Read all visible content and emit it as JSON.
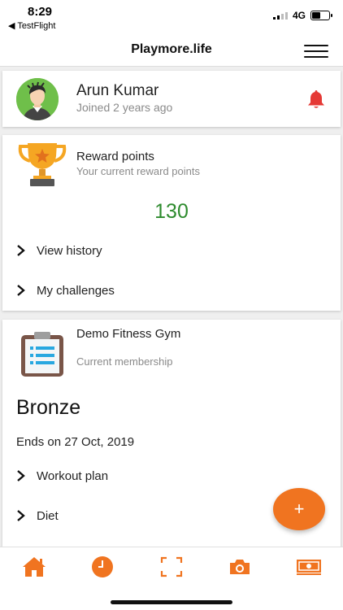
{
  "status_bar": {
    "time": "8:29",
    "back_label": "◀ TestFlight",
    "network": "4G"
  },
  "header": {
    "title": "Playmore.life"
  },
  "profile": {
    "name": "Arun Kumar",
    "joined": "Joined 2 years ago"
  },
  "rewards": {
    "title": "Reward points",
    "subtitle": "Your current reward points",
    "points": "130",
    "links": [
      "View history",
      "My challenges"
    ]
  },
  "membership": {
    "gym_name": "Demo Fitness Gym",
    "subtitle": "Current membership",
    "tier": "Bronze",
    "ends_on": "Ends on 27 Oct, 2019",
    "links": [
      "Workout plan",
      "Diet"
    ]
  },
  "fab": {
    "symbol": "+"
  },
  "bottom_nav": {
    "icons": [
      "home-icon",
      "clock-icon",
      "scan-icon",
      "camera-icon",
      "money-icon"
    ]
  },
  "colors": {
    "accent": "#f07420",
    "points": "#2e8b2e",
    "bell": "#e53935"
  }
}
